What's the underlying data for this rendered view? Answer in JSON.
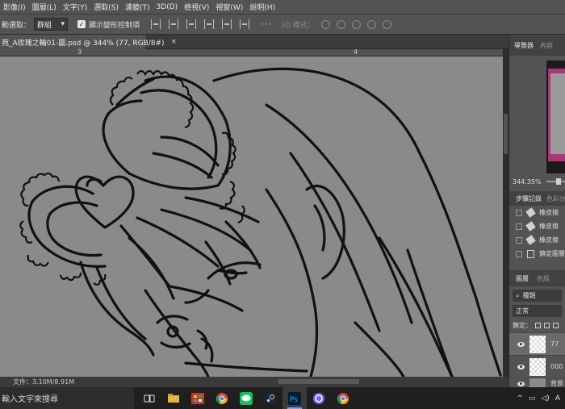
{
  "menu": [
    "影像(I)",
    "圖層(L)",
    "文字(Y)",
    "選取(S)",
    "濾鏡(T)",
    "3D(D)",
    "檢視(V)",
    "視窗(W)",
    "說明(H)"
  ],
  "options": {
    "auto_select_label": "動選取：",
    "auto_select_value": "群組",
    "show_transform_label": "顯示變形控制項",
    "mode_3d_label": "3D 模式："
  },
  "document": {
    "tab_title": "苑_A玫瑰之輪01-圖.psd @ 344% (77, RGB/8#)",
    "close": "×",
    "ruler_labels": [
      "3",
      "4"
    ],
    "status": "文件：3.10M/8.91M"
  },
  "panels": {
    "top_tabs": [
      "導覽器",
      "內容"
    ],
    "zoom": "344.35%",
    "history_tabs": [
      "步驟記錄",
      "色彩分"
    ],
    "history_items": [
      "橡皮擦",
      "橡皮擦",
      "橡皮擦",
      "鎖定圖層"
    ],
    "layer_tabs": [
      "圖層",
      "色版"
    ],
    "kind_label": "種類",
    "blend_mode": "正常",
    "lock_label": "鎖定：",
    "layers": [
      {
        "name": "77"
      },
      {
        "name": "000"
      },
      {
        "name": "背景"
      }
    ]
  },
  "taskbar": {
    "search_placeholder": "輸入文字來搜尋",
    "tray_lang": "A"
  },
  "colors": {
    "canvas_bg": "#8a8a8a",
    "ui_panel": "#535353",
    "line_art": "#111111",
    "nav_accent": "#b0337a"
  }
}
